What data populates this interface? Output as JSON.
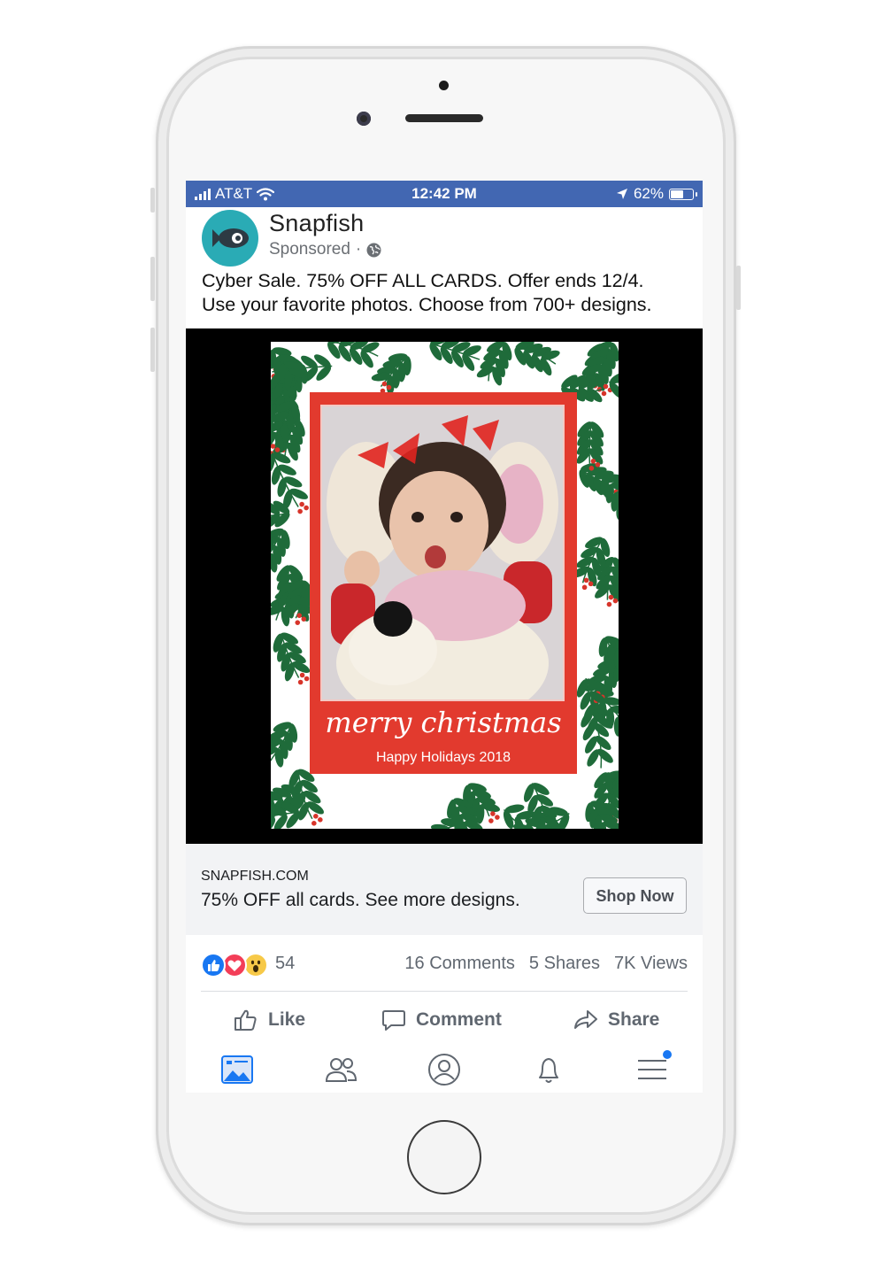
{
  "status_bar": {
    "carrier": "AT&T",
    "time": "12:42 PM",
    "battery": "62%",
    "battery_level": 0.62
  },
  "post": {
    "page_name": "Snapfish",
    "sponsored_label": "Sponsored",
    "separator": "·",
    "text_line1": "Cyber Sale. 75% OFF ALL CARDS. Offer ends 12/4.",
    "text_line2": "Use your favorite photos. Choose from 700+ designs."
  },
  "card": {
    "title": "merry christmas",
    "subtitle": "Happy Holidays 2018",
    "colors": {
      "frame": "#e23a2e",
      "leaf": "#1f6b3a",
      "berry": "#d7342a"
    }
  },
  "link": {
    "domain": "SNAPFISH.COM",
    "description": "75% OFF all cards. See more designs.",
    "cta": "Shop Now"
  },
  "stats": {
    "reactions_count": "54",
    "comments": "16 Comments",
    "shares": "5 Shares",
    "views": "7K Views",
    "reaction_icons": [
      "like-icon",
      "love-icon",
      "wow-icon"
    ]
  },
  "actions": {
    "like": "Like",
    "comment": "Comment",
    "share": "Share"
  },
  "tabbar": {
    "items": [
      "news-feed-icon",
      "friends-icon",
      "profile-icon",
      "notifications-icon",
      "menu-icon"
    ],
    "active": "news-feed-icon"
  },
  "theme": {
    "brand": "#4267b2",
    "accent": "#1877f2",
    "text_secondary": "#606770"
  }
}
